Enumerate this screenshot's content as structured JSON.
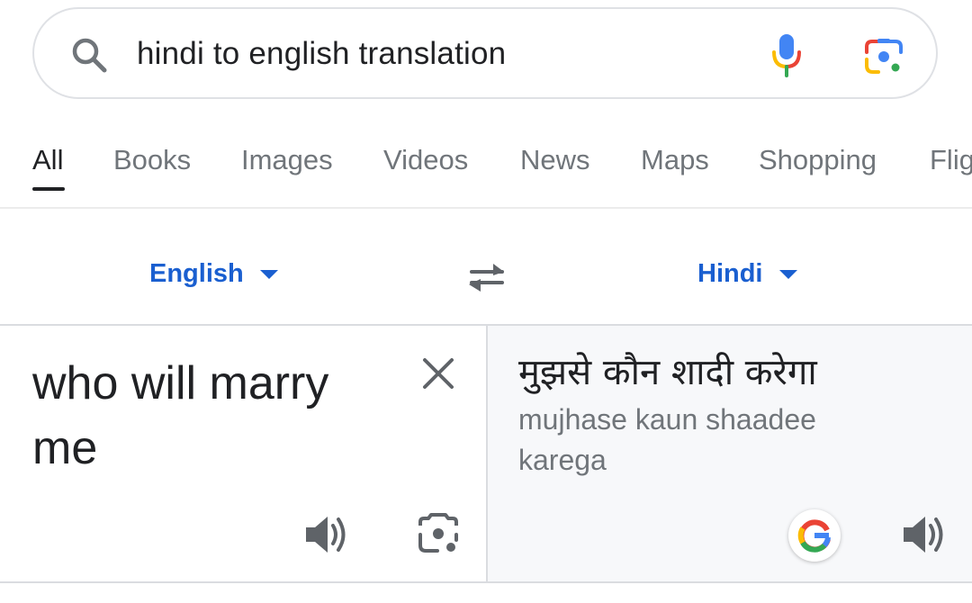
{
  "search": {
    "query": "hindi to english translation",
    "icons": {
      "search": "search-icon",
      "voice": "microphone-icon",
      "lens": "google-lens-icon"
    }
  },
  "tabs": [
    {
      "label": "All",
      "active": true
    },
    {
      "label": "Books"
    },
    {
      "label": "Images"
    },
    {
      "label": "Videos"
    },
    {
      "label": "News"
    },
    {
      "label": "Maps"
    },
    {
      "label": "Shopping"
    },
    {
      "label": "Flig"
    }
  ],
  "translator": {
    "source_language": "English",
    "target_language": "Hindi",
    "source_text": "who will marry me",
    "target_text": "मुझसे कौन शादी करेगा",
    "transliteration": "mujhase kaun shaadee karega"
  },
  "colors": {
    "link_blue": "#1a5fd0",
    "text": "#202124",
    "secondary_text": "#70757a",
    "panel_bg": "#f7f8fa",
    "google_blue": "#4285f4",
    "google_red": "#ea4335",
    "google_yellow": "#fbbc04",
    "google_green": "#34a853"
  }
}
